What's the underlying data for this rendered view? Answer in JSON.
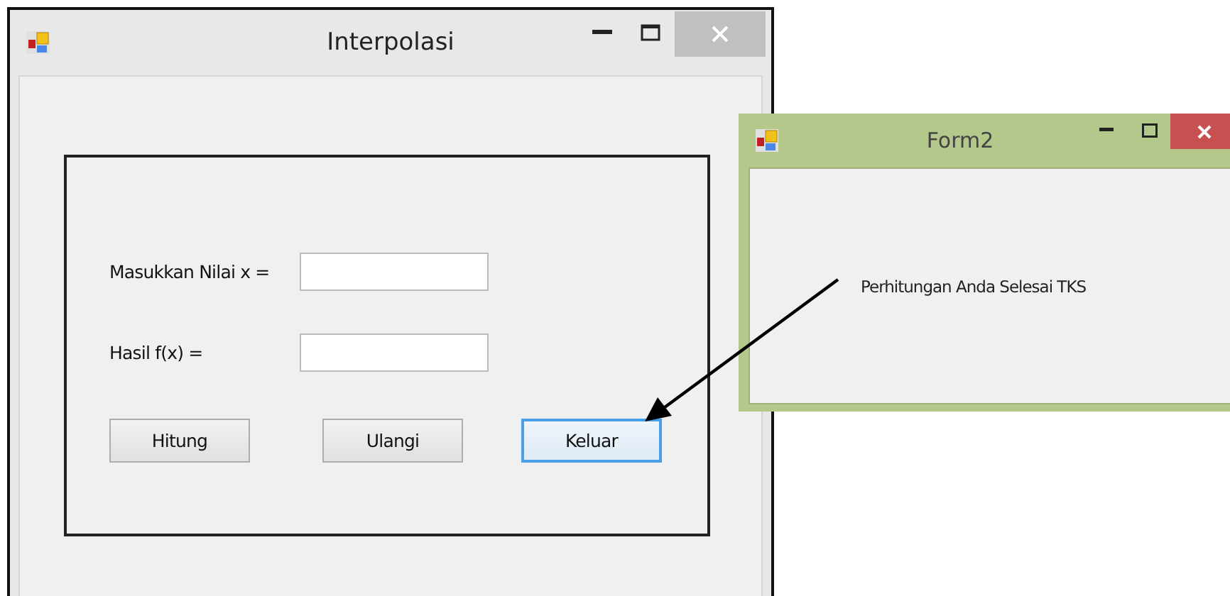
{
  "main_window": {
    "title": "Interpolasi",
    "fields": [
      {
        "label": "Masukkan Nilai x ="
      },
      {
        "label": "Hasil f(x) ="
      }
    ],
    "buttons": [
      {
        "label": "Hitung",
        "focused": false
      },
      {
        "label": "Ulangi",
        "focused": false
      },
      {
        "label": "Keluar",
        "focused": true
      }
    ]
  },
  "form2": {
    "title": "Form2",
    "message": "Perhitungan Anda Selesai TKS"
  }
}
